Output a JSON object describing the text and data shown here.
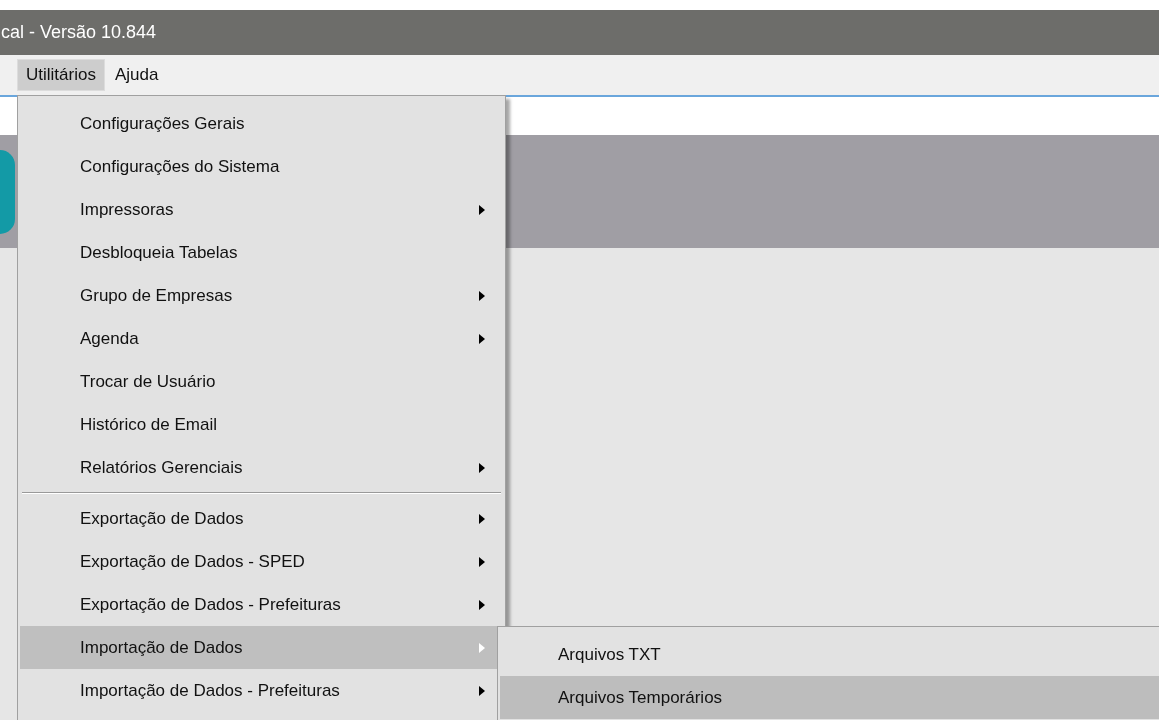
{
  "window": {
    "title": "cal - Versão 10.844"
  },
  "menu_bar": [
    {
      "label": "Utilitários",
      "selected": true
    },
    {
      "label": "Ajuda",
      "selected": false
    }
  ],
  "dropdown": [
    {
      "kind": "item",
      "label": "Configurações Gerais",
      "submenu": false,
      "selected": false
    },
    {
      "kind": "item",
      "label": "Configurações do Sistema",
      "submenu": false,
      "selected": false
    },
    {
      "kind": "item",
      "label": "Impressoras",
      "submenu": true,
      "selected": false
    },
    {
      "kind": "item",
      "label": "Desbloqueia Tabelas",
      "submenu": false,
      "selected": false
    },
    {
      "kind": "item",
      "label": "Grupo de Empresas",
      "submenu": true,
      "selected": false
    },
    {
      "kind": "item",
      "label": "Agenda",
      "submenu": true,
      "selected": false
    },
    {
      "kind": "item",
      "label": "Trocar de Usuário",
      "submenu": false,
      "selected": false
    },
    {
      "kind": "item",
      "label": "Histórico de Email",
      "submenu": false,
      "selected": false
    },
    {
      "kind": "item",
      "label": "Relatórios Gerenciais",
      "submenu": true,
      "selected": false
    },
    {
      "kind": "separator"
    },
    {
      "kind": "item",
      "label": "Exportação de Dados",
      "submenu": true,
      "selected": false
    },
    {
      "kind": "item",
      "label": "Exportação de Dados - SPED",
      "submenu": true,
      "selected": false
    },
    {
      "kind": "item",
      "label": "Exportação de Dados - Prefeituras",
      "submenu": true,
      "selected": false
    },
    {
      "kind": "item",
      "label": "Importação de Dados",
      "submenu": true,
      "selected": true
    },
    {
      "kind": "item",
      "label": "Importação de Dados - Prefeituras",
      "submenu": true,
      "selected": false
    }
  ],
  "submenu": [
    {
      "label": "Arquivos TXT",
      "selected": false
    },
    {
      "label": "Arquivos Temporários",
      "selected": true
    }
  ]
}
